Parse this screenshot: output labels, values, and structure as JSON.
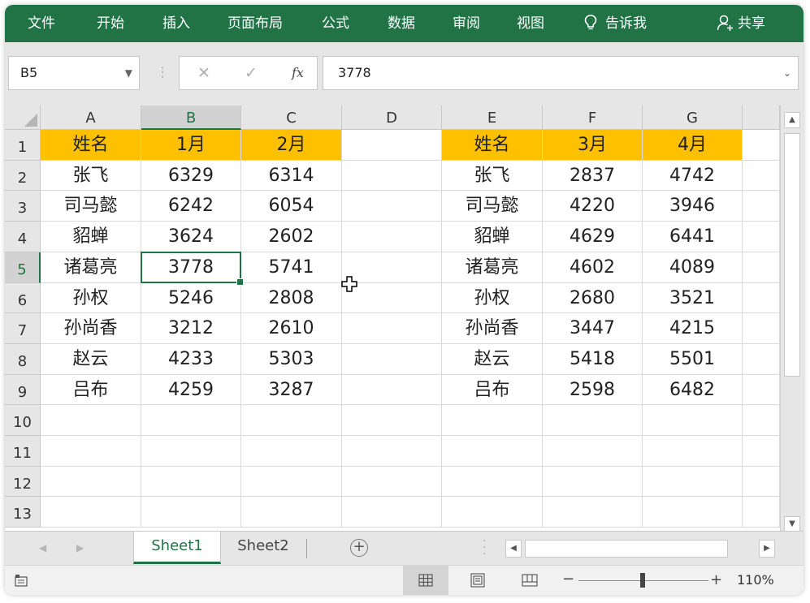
{
  "ribbon": {
    "tabs": [
      "文件",
      "开始",
      "插入",
      "页面布局",
      "公式",
      "数据",
      "审阅",
      "视图"
    ],
    "tell_me": "告诉我",
    "share": "共享"
  },
  "formula_bar": {
    "name_box": "B5",
    "formula_value": "3778",
    "fx_label": "fx"
  },
  "columns": [
    "A",
    "B",
    "C",
    "D",
    "E",
    "F",
    "G"
  ],
  "rows": [
    "1",
    "2",
    "3",
    "4",
    "5",
    "6",
    "7",
    "8",
    "9",
    "10",
    "11",
    "12",
    "13"
  ],
  "table_left": {
    "headers": [
      "姓名",
      "1月",
      "2月"
    ],
    "data": [
      [
        "张飞",
        "6329",
        "6314"
      ],
      [
        "司马懿",
        "6242",
        "6054"
      ],
      [
        "貂蝉",
        "3624",
        "2602"
      ],
      [
        "诸葛亮",
        "3778",
        "5741"
      ],
      [
        "孙权",
        "5246",
        "2808"
      ],
      [
        "孙尚香",
        "3212",
        "2610"
      ],
      [
        "赵云",
        "4233",
        "5303"
      ],
      [
        "吕布",
        "4259",
        "3287"
      ]
    ]
  },
  "table_right": {
    "headers": [
      "姓名",
      "3月",
      "4月"
    ],
    "data": [
      [
        "张飞",
        "2837",
        "4742"
      ],
      [
        "司马懿",
        "4220",
        "3946"
      ],
      [
        "貂蝉",
        "4629",
        "6441"
      ],
      [
        "诸葛亮",
        "4602",
        "4089"
      ],
      [
        "孙权",
        "2680",
        "3521"
      ],
      [
        "孙尚香",
        "3447",
        "4215"
      ],
      [
        "赵云",
        "5418",
        "5501"
      ],
      [
        "吕布",
        "2598",
        "6482"
      ]
    ]
  },
  "selected": {
    "col": "B",
    "row": "5"
  },
  "sheets": [
    "Sheet1",
    "Sheet2"
  ],
  "active_sheet": "Sheet1",
  "status": {
    "zoom": "110%"
  },
  "colors": {
    "accent": "#217346",
    "header_fill": "#ffc000"
  }
}
